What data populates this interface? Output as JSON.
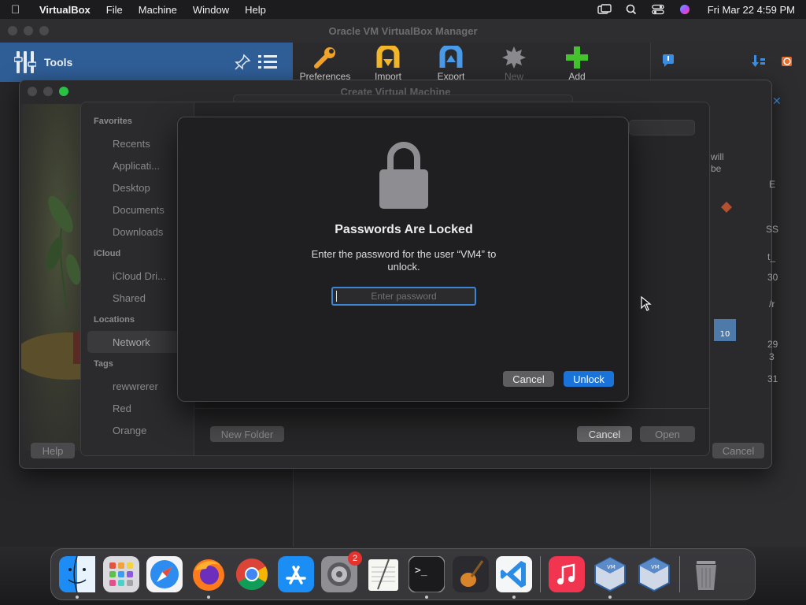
{
  "menubar": {
    "app_name": "VirtualBox",
    "items": [
      "File",
      "Machine",
      "Window",
      "Help"
    ],
    "clock": "Fri Mar 22  4:59 PM"
  },
  "vbox_manager": {
    "title": "Oracle VM VirtualBox Manager",
    "tools_label": "Tools",
    "toolbar": {
      "preferences": "Preferences",
      "import": "Import",
      "export": "Export",
      "new": "New",
      "add": "Add"
    }
  },
  "create_vm": {
    "title": "Create Virtual Machine",
    "help_label": "Help",
    "cancel_label": "Cancel",
    "right_fragments": [
      "will",
      "be",
      "E",
      "SS",
      "t_",
      "30",
      "/r",
      "29",
      "3",
      "31"
    ]
  },
  "open_dialog": {
    "sidebar": {
      "favorites_heading": "Favorites",
      "favorites": [
        "Recents",
        "Applicati...",
        "Desktop",
        "Documents",
        "Downloads"
      ],
      "icloud_heading": "iCloud",
      "icloud": [
        "iCloud Dri...",
        "Shared"
      ],
      "locations_heading": "Locations",
      "locations": [
        "Network"
      ],
      "tags_heading": "Tags",
      "tags": [
        "rewwrerer",
        "Red",
        "Orange"
      ]
    },
    "new_folder_label": "New Folder",
    "cancel_label": "Cancel",
    "open_label": "Open"
  },
  "password_dialog": {
    "title": "Passwords Are Locked",
    "message": "Enter the password for the user “VM4” to unlock.",
    "input_placeholder": "Enter password",
    "input_value": "",
    "cancel_label": "Cancel",
    "unlock_label": "Unlock"
  },
  "dock": {
    "items": [
      {
        "name": "Finder",
        "icon": "finder-icon"
      },
      {
        "name": "Launchpad",
        "icon": "launchpad-icon"
      },
      {
        "name": "Safari",
        "icon": "safari-icon"
      },
      {
        "name": "Firefox",
        "icon": "firefox-icon"
      },
      {
        "name": "Chrome",
        "icon": "chrome-icon"
      },
      {
        "name": "App Store",
        "icon": "app-store-icon"
      },
      {
        "name": "System Settings",
        "icon": "settings-icon",
        "badge": "2"
      },
      {
        "name": "TextEdit",
        "icon": "textedit-icon"
      },
      {
        "name": "Terminal",
        "icon": "terminal-icon"
      },
      {
        "name": "GarageBand",
        "icon": "garageband-icon"
      },
      {
        "name": "VS Code",
        "icon": "vscode-icon"
      },
      {
        "name": "Music",
        "icon": "music-icon"
      },
      {
        "name": "VirtualBox",
        "icon": "virtualbox-icon"
      },
      {
        "name": "VirtualBox",
        "icon": "virtualbox-icon"
      },
      {
        "name": "Trash",
        "icon": "trash-icon"
      }
    ]
  },
  "colors": {
    "accent": "#1a73d9",
    "focus_ring": "#3b84d6",
    "tools_bar": "#2f5e97",
    "badge": "#e5322d"
  }
}
